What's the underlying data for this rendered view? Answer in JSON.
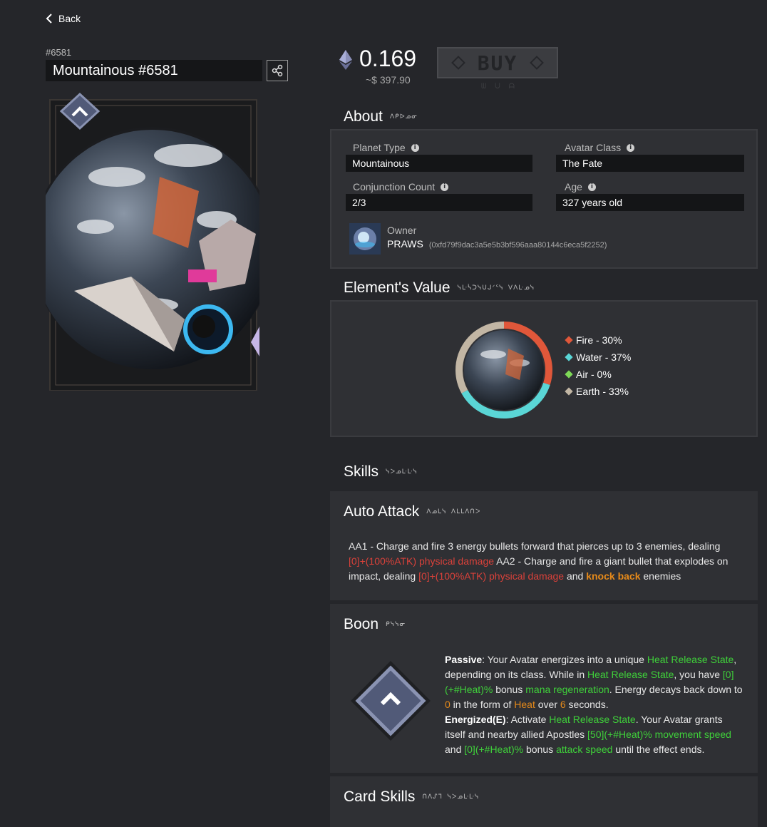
{
  "nav": {
    "back_label": "Back"
  },
  "asset": {
    "id_label": "#6581",
    "name": "Mountainous #6581"
  },
  "price": {
    "eth": "0.169",
    "usd": "~$ 397.90",
    "buy_label": "BUY",
    "buy_glyphs": "ᗯ ᑌ ᗩ"
  },
  "about": {
    "title": "About",
    "glyphs": "ᐱᑭᐅᓄᓂ",
    "planet_type": {
      "label": "Planet Type",
      "value": "Mountainous"
    },
    "avatar_class": {
      "label": "Avatar Class",
      "value": "The Fate"
    },
    "conjunction": {
      "label": "Conjunction Count",
      "value": "2/3"
    },
    "age": {
      "label": "Age",
      "value": "327 years old"
    },
    "owner": {
      "label": "Owner",
      "name": "PRAWS",
      "address": "(0xfd79f9dac3a5e5b3bf596aaa80144c6eca5f2252)"
    }
  },
  "element": {
    "title": "Element's Value",
    "glyphs": "ᓭᒷᓵᑐᓭᑌᒍᐟᕐᓭ ᐯᐱᒷᓄᓭ",
    "legend": [
      {
        "label": "Fire - 30%",
        "color": "#e0573a"
      },
      {
        "label": "Water - 37%",
        "color": "#5ad6d6"
      },
      {
        "label": "Air - 0%",
        "color": "#7ed957"
      },
      {
        "label": "Earth - 33%",
        "color": "#c2b6a4"
      }
    ]
  },
  "chart_data": {
    "type": "pie",
    "categories": [
      "Fire",
      "Water",
      "Air",
      "Earth"
    ],
    "values": [
      30,
      37,
      0,
      33
    ],
    "colors": [
      "#e0573a",
      "#5ad6d6",
      "#7ed957",
      "#c2b6a4"
    ]
  },
  "skills": {
    "title": "Skills",
    "glyphs": "ᓭᐳᓄᒷᒷᓭ",
    "auto_attack": {
      "name": "Auto Attack",
      "glyphs": "ᐱᓄᒪᓭ ᐱᒪᒪᐱᑎᐳ",
      "t1": "AA1 - Charge and fire 3 energy bullets forward that pierces up to 3 enemies, dealing ",
      "t2": "[0]+(100%ATK) physical damage",
      "t3": " AA2 - Charge and fire a giant bullet that explodes on impact, dealing ",
      "t4": "[0]+(100%ATK) physical damage",
      "t5": " and ",
      "t6": "knock back",
      "t7": " enemies"
    },
    "boon": {
      "name": "Boon",
      "glyphs": "ᑭᓭᓭᓂ",
      "p1": "Passive",
      "p2": ": Your Avatar energizes into a unique ",
      "p3": "Heat Release State",
      "p4": ", depending on its class. While in ",
      "p5": "Heat Release State",
      "p6": ", you have ",
      "p7": "[0](+#Heat)%",
      "p8": " bonus ",
      "p9": "mana regeneration",
      "p10": ". Energy decays back down to ",
      "p11": "0",
      "p12": " in the form of ",
      "p13": "Heat",
      "p14": " over ",
      "p15": "6",
      "p16": " seconds.",
      "e1": "Energized(E)",
      "e2": ": Activate ",
      "e3": "Heat Release State",
      "e4": ". Your Avatar grants itself and nearby allied Apostles ",
      "e5": "[50](+#Heat)%",
      "e6": " ",
      "e7": "movement speed",
      "e8": " and ",
      "e9": "[0](+#Heat)%",
      "e10": " bonus ",
      "e11": "attack speed",
      "e12": " until the effect ends."
    },
    "card_skills": {
      "name": "Card Skills",
      "glyphs": "ᑎᐱᔑᒣ ᓭᐳᓄᒷᒷᓭ"
    }
  }
}
